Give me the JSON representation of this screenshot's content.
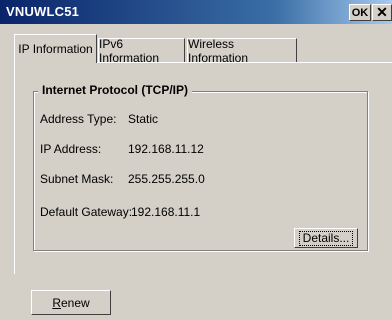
{
  "window": {
    "title": "VNUWLC51",
    "ok_label": "OK",
    "close_label": "✕",
    "ok_icon": "ok-button-icon",
    "close_icon": "close-icon"
  },
  "tabs": [
    {
      "label": "IP Information",
      "active": true
    },
    {
      "label": "IPv6 Information",
      "active": false
    },
    {
      "label": "Wireless Information",
      "active": false
    }
  ],
  "group": {
    "title": "Internet Protocol (TCP/IP)",
    "fields": [
      {
        "label": "Address Type:",
        "value": "Static"
      },
      {
        "label": "IP Address:",
        "value": "192.168.11.12"
      },
      {
        "label": "Subnet Mask:",
        "value": "255.255.255.0"
      },
      {
        "label": "Default Gateway:",
        "value": "192.168.11.1"
      }
    ]
  },
  "buttons": {
    "details_label": "Details...",
    "renew_first": "R",
    "renew_rest": "enew"
  }
}
